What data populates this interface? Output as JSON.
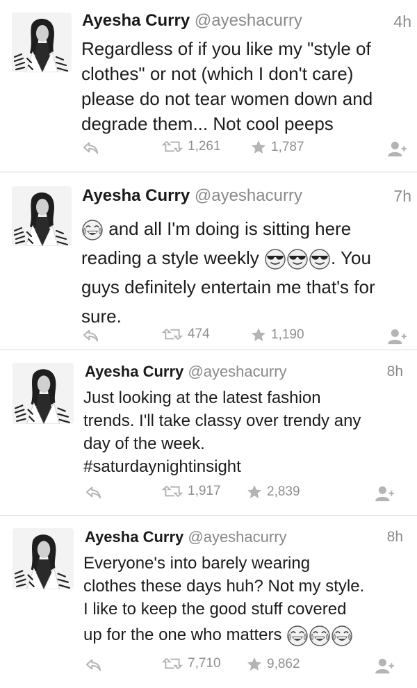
{
  "tweets": [
    {
      "name": "Ayesha Curry",
      "handle": "@ayeshacurry",
      "time": "4h",
      "lines": [
        "Regardless of if you like my \"style of",
        "clothes\" or not (which I don't care)",
        "please do not tear women down and",
        "degrade them... Not cool peeps"
      ],
      "retweets": "1,261",
      "favorites": "1,787"
    },
    {
      "name": "Ayesha Curry",
      "handle": "@ayeshacurry",
      "time": "7h",
      "line1": "and all I'm doing is sitting here",
      "line2_pre": "reading a style weekly",
      "line2_post": ". You",
      "line3": "guys definitely entertain me that's for",
      "line4": "sure.",
      "retweets": "474",
      "favorites": "1,190"
    },
    {
      "name": "Ayesha Curry",
      "handle": "@ayeshacurry",
      "time": "8h",
      "lines": [
        "Just looking at the latest fashion",
        "trends. I'll take classy over trendy any",
        "day of the week.",
        "#saturdaynightinsight"
      ],
      "retweets": "1,917",
      "favorites": "2,839"
    },
    {
      "name": "Ayesha Curry",
      "handle": "@ayeshacurry",
      "time": "8h",
      "lines": [
        "Everyone's into barely wearing",
        "clothes these days huh? Not my style.",
        "I like to keep the good stuff covered"
      ],
      "line4": "up for the one who matters",
      "retweets": "7,710",
      "favorites": "9,862"
    }
  ],
  "icons": {
    "reply": "reply-icon",
    "retweet": "retweet-icon",
    "favorite": "star-icon",
    "follow": "follow-user-icon",
    "laugh": "tears-of-joy-emoji",
    "cool": "sunglasses-emoji"
  },
  "colors": {
    "icon_gray": "#b4b4b4",
    "text": "#1c1c1c",
    "meta": "#8a8a8a",
    "divider": "#d9d9d9"
  }
}
